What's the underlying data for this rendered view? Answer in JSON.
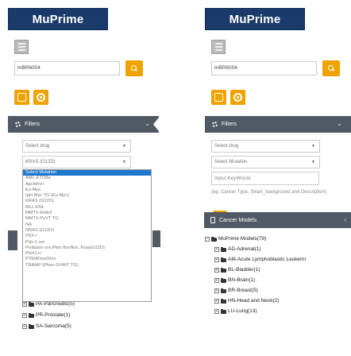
{
  "logo": {
    "text": "MuPrime"
  },
  "left": {
    "search": {
      "value": "mBR6004"
    },
    "filters_label": "Filters",
    "select_drug": "Select drug",
    "select_mutation_value": "KRAS (G12D)",
    "dropdown_options": [
      "Select Mutation",
      "AML-ETO9a",
      "ApcMin/+",
      "Eu-Myc",
      "IgH-Myc TG (Eu Myc)",
      "KRAS (G12D)",
      "MLL-ENL",
      "MMTV-Erbb2",
      "MMTV-PyVT TG",
      "NA",
      "NRAS (G12D)",
      "P53-/-",
      "Pdx-1 cre",
      "Probasin-cre,Pten flox/flox, Kras(G12D)",
      "Ptch1+/-",
      "PTENFlox/Flox",
      "TRAMP (Pbsn-SV40T TG)"
    ],
    "tree_rows": [
      {
        "label": "PA-Pancreatic(5)",
        "box": "+"
      },
      {
        "label": "PR-Prostate(1)",
        "box": "+"
      },
      {
        "label": "SA-Sarcoma(5)",
        "box": "+"
      }
    ]
  },
  "right": {
    "search": {
      "value": "mBR6004"
    },
    "filters_label": "Filters",
    "select_drug": "Select drug",
    "select_mutation": "Select Mutation",
    "input_placeholder": "Input KeyWords",
    "hint": "(eg. Cancer Type, Strain_background and Description)",
    "models_label": "Cancer Models",
    "tree_root": "MuPrime Models(79)",
    "tree_rows": [
      {
        "label": "AD-Adrenal(1)",
        "box": "+"
      },
      {
        "label": "AM-Acute Lymphoblastic Leukemi",
        "box": "+"
      },
      {
        "label": "BL-Bladder(1)",
        "box": "+"
      },
      {
        "label": "BN-Brain(1)",
        "box": "+"
      },
      {
        "label": "BR-Breast(5)",
        "box": "+"
      },
      {
        "label": "HN-Head and Neck(2)",
        "box": "+"
      },
      {
        "label": "LU-Lung(13)",
        "box": "+"
      }
    ]
  },
  "colors": {
    "brand": "#1a3a6b",
    "accent": "#f0a300",
    "bar": "#505a65",
    "selected": "#1e78d0"
  }
}
